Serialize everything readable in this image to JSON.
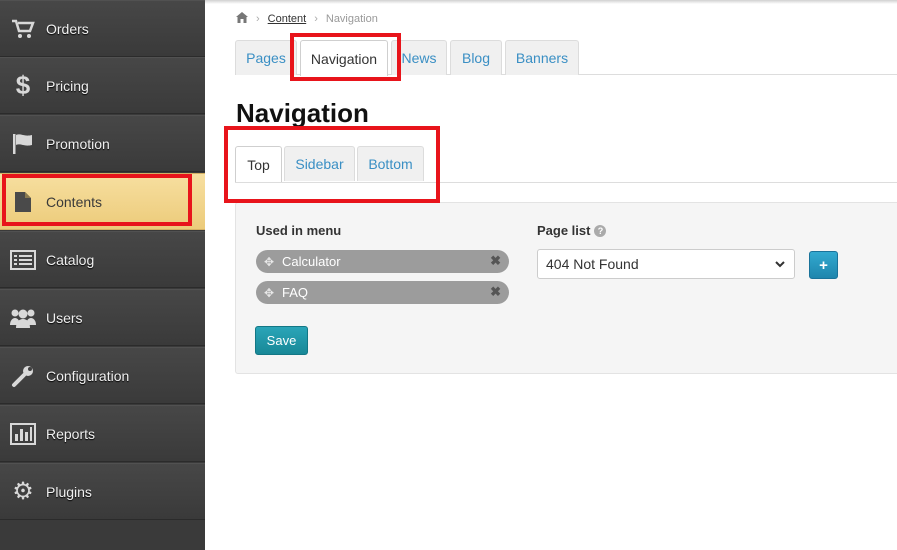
{
  "sidebar": {
    "items": [
      {
        "label": "Orders",
        "icon": "cart-icon"
      },
      {
        "label": "Pricing",
        "icon": "dollar-icon"
      },
      {
        "label": "Promotion",
        "icon": "flag-icon"
      },
      {
        "label": "Contents",
        "icon": "document-icon"
      },
      {
        "label": "Catalog",
        "icon": "list-icon"
      },
      {
        "label": "Users",
        "icon": "users-icon"
      },
      {
        "label": "Configuration",
        "icon": "wrench-icon"
      },
      {
        "label": "Reports",
        "icon": "bar-chart-icon"
      },
      {
        "label": "Plugins",
        "icon": "gear-icon"
      }
    ],
    "active": "Contents"
  },
  "breadcrumb": {
    "home_icon": "home-icon",
    "link": "Content",
    "current": "Navigation"
  },
  "top_tabs": {
    "items": [
      "Pages",
      "Navigation",
      "News",
      "Blog",
      "Banners"
    ],
    "active": "Navigation"
  },
  "page_title": "Navigation",
  "sub_tabs": {
    "items": [
      "Top",
      "Sidebar",
      "Bottom"
    ],
    "active": "Top"
  },
  "menu_panel": {
    "used_label": "Used in menu",
    "items": [
      "Calculator",
      "FAQ"
    ],
    "page_list_label": "Page list",
    "page_list_selected": "404 Not Found",
    "add_button": "+",
    "save_label": "Save"
  },
  "colors": {
    "highlight": "#e8141b",
    "link": "#3a8fc4",
    "active_sidebar": "#f3d68d",
    "save": "#1f95a6"
  }
}
